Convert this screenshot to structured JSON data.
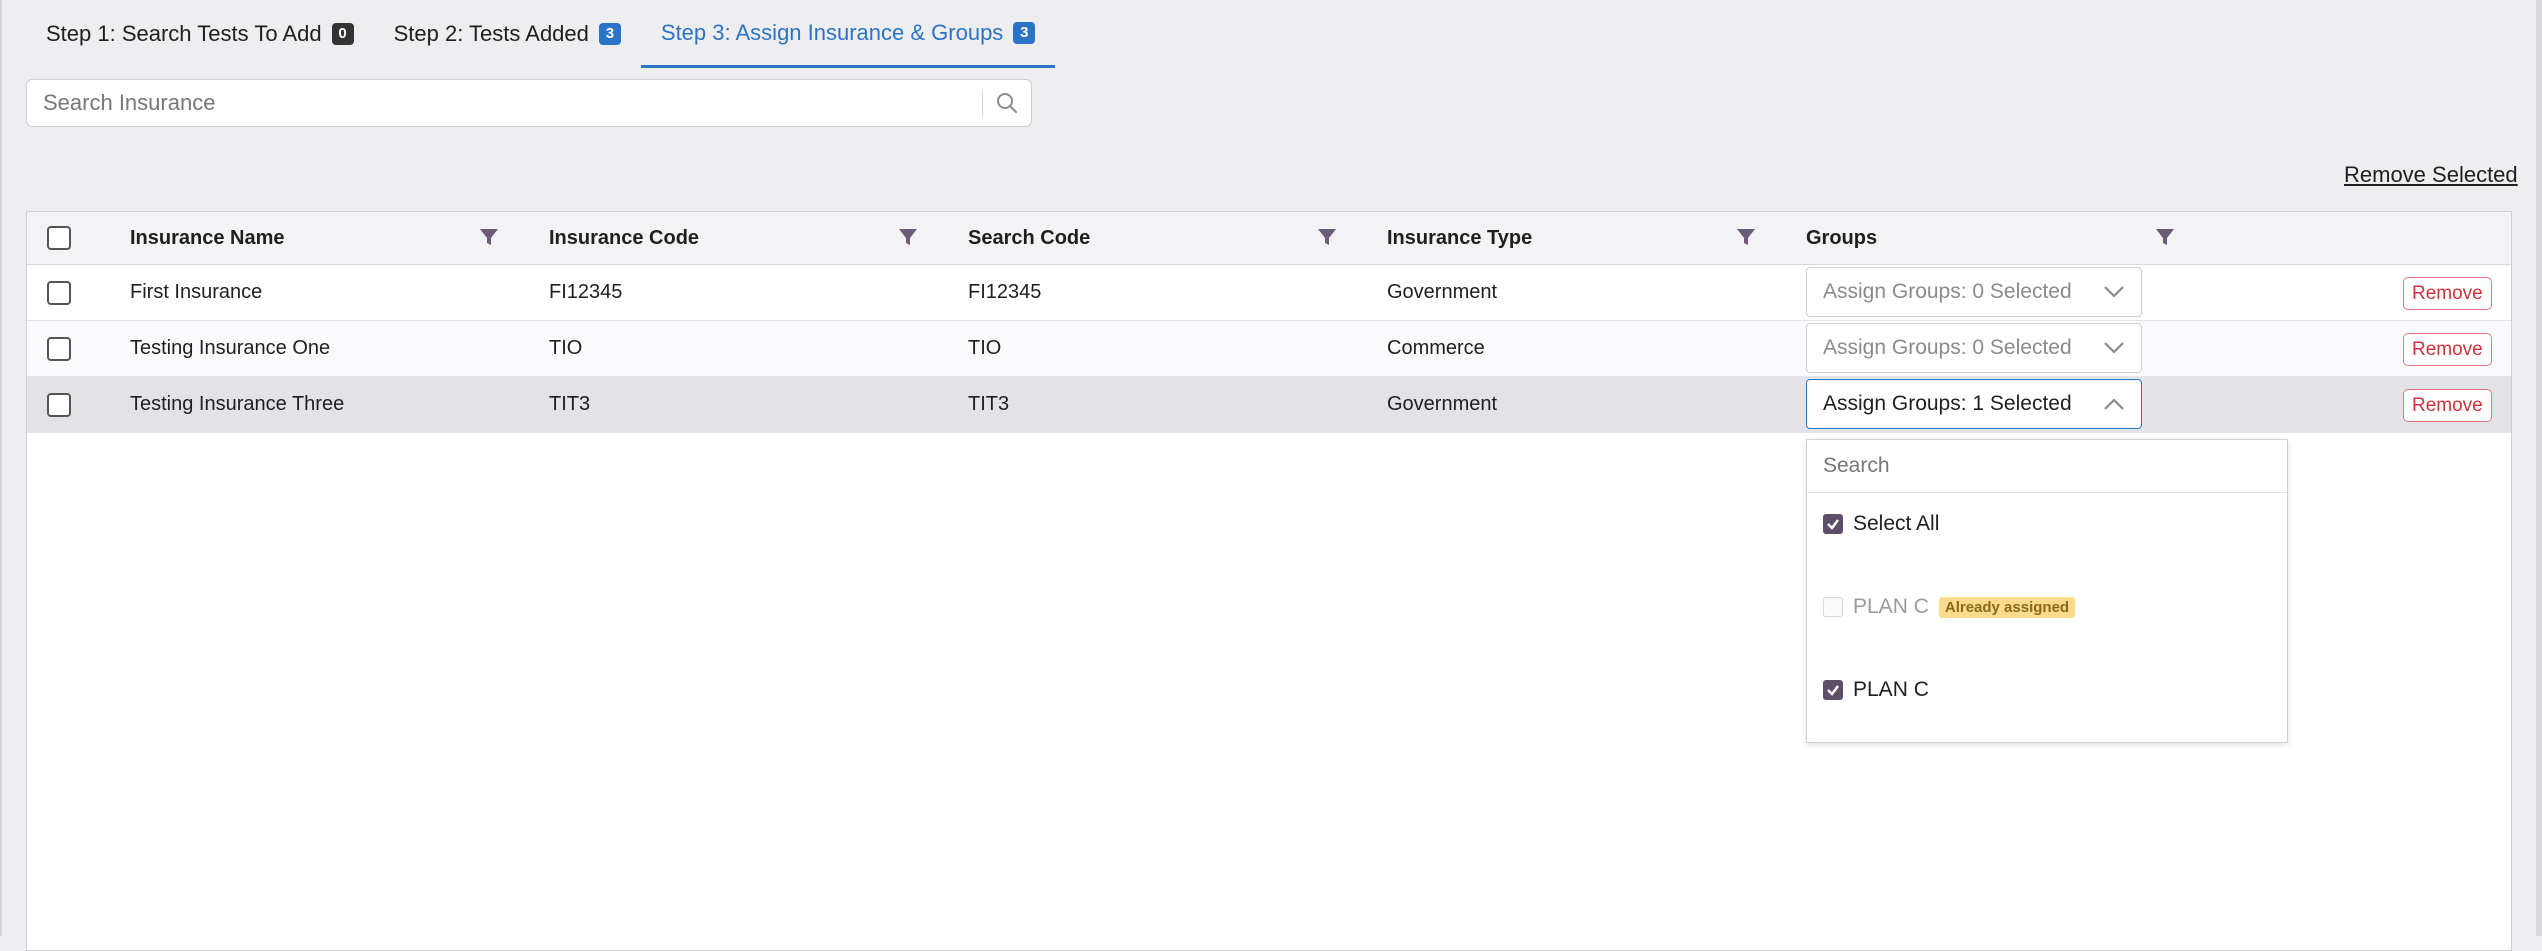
{
  "tabs": [
    {
      "label": "Step 1: Search Tests To Add",
      "count": "0"
    },
    {
      "label": "Step 2: Tests Added",
      "count": "3"
    },
    {
      "label": "Step 3: Assign Insurance & Groups",
      "count": "3"
    }
  ],
  "search": {
    "placeholder": "Search Insurance"
  },
  "actions": {
    "remove_selected": "Remove Selected"
  },
  "table": {
    "columns": [
      "Insurance Name",
      "Insurance Code",
      "Search Code",
      "Insurance Type",
      "Groups"
    ],
    "rows": [
      {
        "name": "First Insurance",
        "code": "FI12345",
        "search_code": "FI12345",
        "type": "Government",
        "groups": "Assign Groups: 0 Selected",
        "remove": "Remove"
      },
      {
        "name": "Testing Insurance One",
        "code": "TIO",
        "search_code": "TIO",
        "type": "Commerce",
        "groups": "Assign Groups: 0 Selected",
        "remove": "Remove"
      },
      {
        "name": "Testing Insurance Three",
        "code": "TIT3",
        "search_code": "TIT3",
        "type": "Government",
        "groups": "Assign Groups: 1 Selected",
        "remove": "Remove"
      }
    ]
  },
  "dropdown": {
    "search_placeholder": "Search",
    "select_all": "Select All",
    "options": [
      {
        "label": "PLAN C",
        "badge": "Already assigned"
      },
      {
        "label": "PLAN C"
      }
    ]
  },
  "colors": {
    "accent": "#2a73c7",
    "danger": "#d2323c",
    "badge": "#fbdc8e"
  },
  "icons": {
    "filter": "filter-icon",
    "search": "search-icon",
    "chevron": "chevron-icon",
    "check": "check-icon"
  }
}
